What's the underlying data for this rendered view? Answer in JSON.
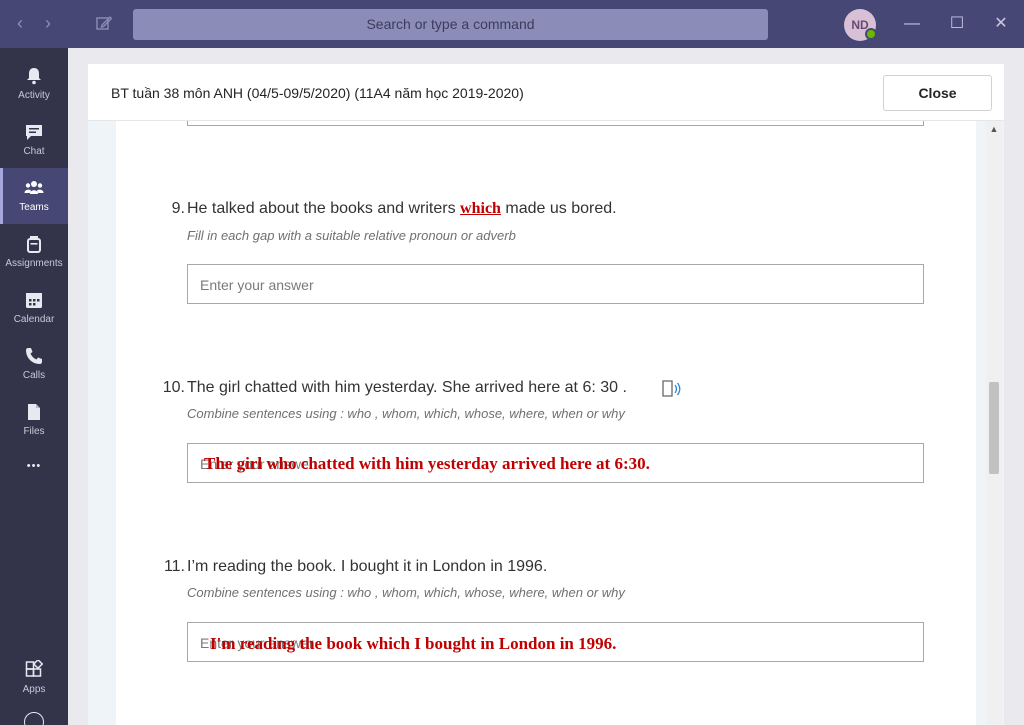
{
  "topbar": {
    "search_placeholder": "Search or type a command",
    "avatar_initials": "ND",
    "back_glyph": "‹",
    "forward_glyph": "›",
    "minimize_glyph": "—",
    "maximize_glyph": "☐",
    "close_glyph": "✕"
  },
  "rail": {
    "items": [
      {
        "label": "Activity",
        "icon": "bell-icon"
      },
      {
        "label": "Chat",
        "icon": "chat-icon"
      },
      {
        "label": "Teams",
        "icon": "teams-icon",
        "active": true
      },
      {
        "label": "Assignments",
        "icon": "assignments-icon"
      },
      {
        "label": "Calendar",
        "icon": "calendar-icon"
      },
      {
        "label": "Calls",
        "icon": "phone-icon"
      },
      {
        "label": "Files",
        "icon": "files-icon"
      },
      {
        "label": "Apps",
        "icon": "apps-icon"
      }
    ],
    "more_glyph": "•••"
  },
  "dialog": {
    "title": "BT tuần 38 môn ANH (04/5-09/5/2020) (11A4 năm học 2019-2020)",
    "close_label": "Close"
  },
  "questions": [
    {
      "number": "9.",
      "text_before": "He talked about the books and writers ",
      "inline_answer": "which",
      "text_after": " made us bored.",
      "hint": "Fill in each gap with a suitable relative pronoun or adverb",
      "placeholder": "Enter your answer",
      "written_answer": ""
    },
    {
      "number": "10.",
      "text": "The girl chatted with him yesterday. She arrived here at 6: 30 .",
      "hint": "Combine sentences using : who , whom, which, whose, where, when or why",
      "placeholder": "Enter your answer",
      "written_answer": "The girl who chatted with him yesterday arrived here at 6:30."
    },
    {
      "number": "11.",
      "text": "I’m reading the book. I bought it in London in 1996.",
      "hint": "Combine sentences using : who , whom, which, whose, where, when or why",
      "placeholder": "Enter your answer",
      "written_answer": "I'm reading the book which I bought in London in 1996."
    }
  ],
  "colors": {
    "topbar": "#464775",
    "rail": "#33344a",
    "answer_ink": "#c00000"
  }
}
